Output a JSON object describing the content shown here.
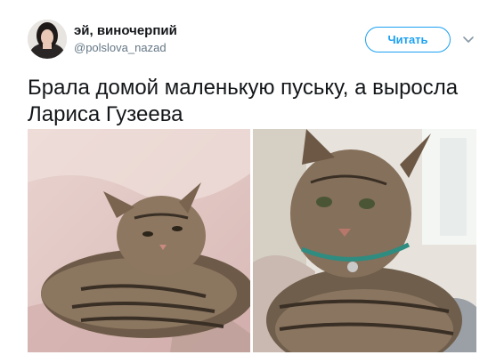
{
  "tweet": {
    "display_name": "эй, виночерпий",
    "handle": "@polslova_nazad",
    "follow_label": "Читать",
    "text": "Брала домой маленькую пуську, а выросла Лариса Гузеева"
  },
  "icons": {
    "caret": "chevron-down-icon"
  },
  "colors": {
    "accent": "#1da1f2",
    "text": "#14171a",
    "secondary": "#657786"
  }
}
